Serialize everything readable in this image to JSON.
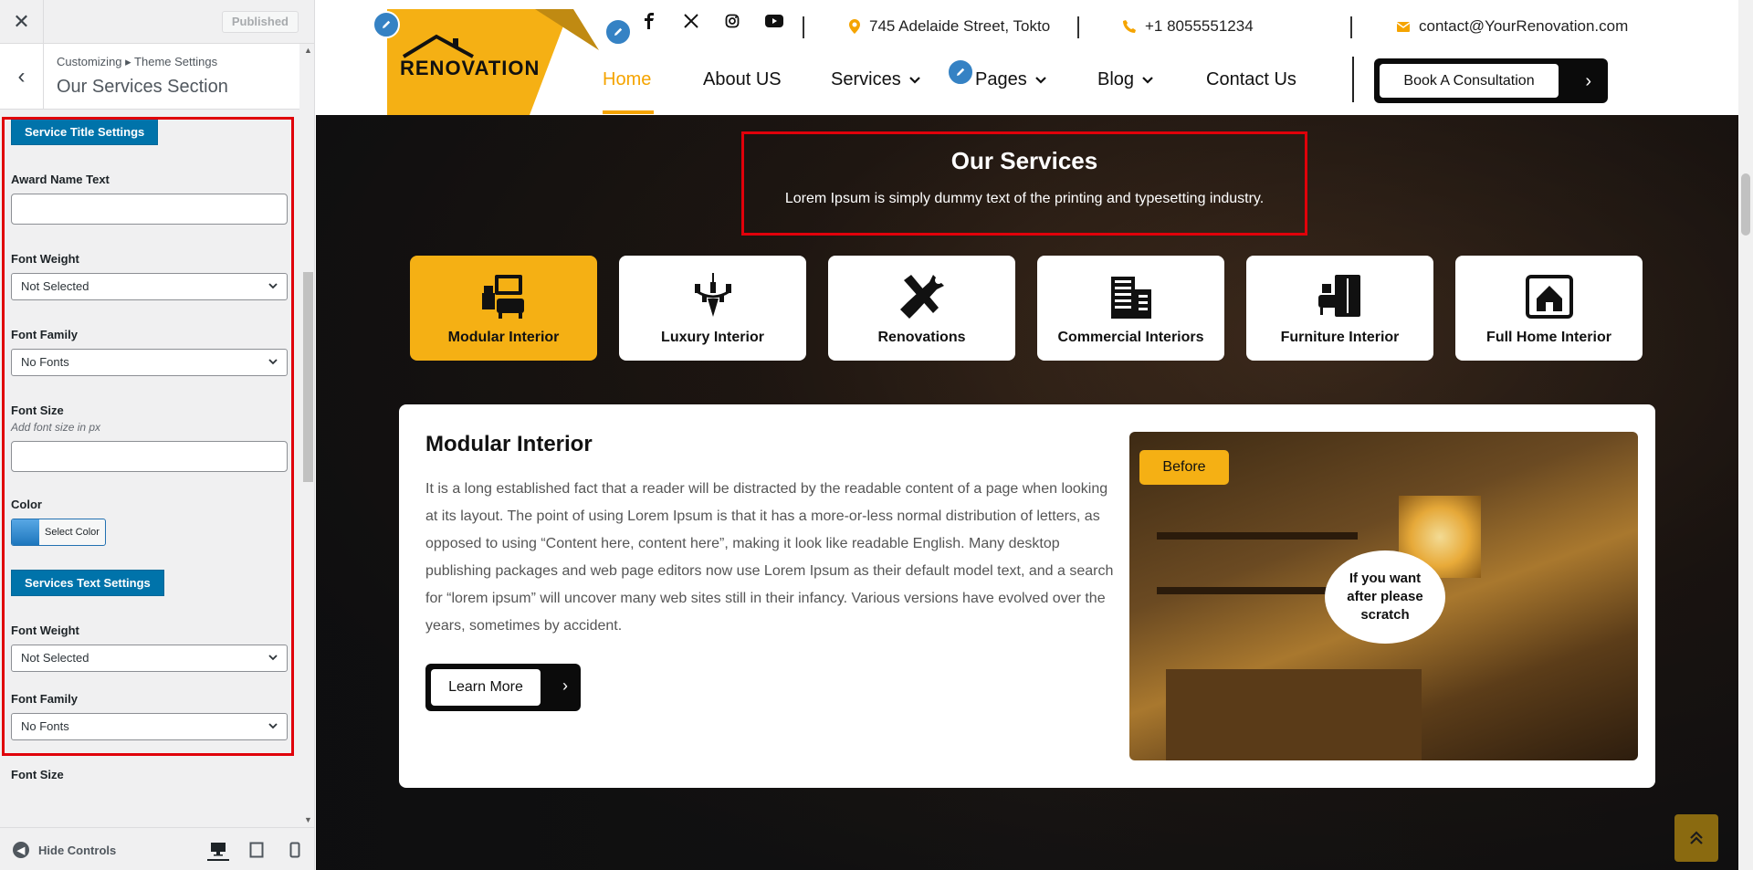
{
  "sidebar": {
    "close_icon": "close-icon",
    "published_label": "Published",
    "breadcrumb": "Customizing ▸ Theme Settings",
    "title": "Our Services Section",
    "service_title_settings_label": "Service Title Settings",
    "award_name_label": "Award Name Text",
    "font_weight_label": "Font Weight",
    "font_weight_value": "Not Selected",
    "font_family_label": "Font Family",
    "font_family_value": "No Fonts",
    "font_size_label": "Font Size",
    "font_size_desc": "Add font size in px",
    "color_label": "Color",
    "select_color_label": "Select Color",
    "services_text_settings_label": "Services Text Settings",
    "font_weight_label_2": "Font Weight",
    "font_weight_value_2": "Not Selected",
    "font_family_label_2": "Font Family",
    "font_family_value_2": "No Fonts",
    "font_size_label_2": "Font Size",
    "hide_controls_label": "Hide Controls"
  },
  "header": {
    "logo_text": "RENOVATION",
    "address": "745 Adelaide Street, Tokto",
    "phone": "+1 8055551234",
    "email": "contact@YourRenovation.com",
    "nav": {
      "home": "Home",
      "about": "About US",
      "services": "Services",
      "pages": "Pages",
      "blog": "Blog",
      "contact": "Contact Us"
    },
    "book_label": "Book A Consultation"
  },
  "services": {
    "title": "Our Services",
    "subtitle": "Lorem Ipsum is simply dummy text of the printing and typesetting industry.",
    "tabs": [
      {
        "label": "Modular Interior"
      },
      {
        "label": "Luxury Interior"
      },
      {
        "label": "Renovations"
      },
      {
        "label": "Commercial Interiors"
      },
      {
        "label": "Furniture Interior"
      },
      {
        "label": "Full Home Interior"
      }
    ],
    "detail": {
      "title": "Modular Interior",
      "text": "It is a long established fact that a reader will be distracted by the readable content of a page when looking at its layout. The point of using Lorem Ipsum is that it has a more-or-less normal distribution of letters, as opposed to using “Content here, content here”, making it look like readable English. Many desktop publishing packages and web page editors now use Lorem Ipsum as their default model text, and a search for “lorem ipsum” will uncover many web sites still in their infancy. Various versions have evolved over the years, sometimes by accident.",
      "learn_more": "Learn More",
      "before_label": "Before",
      "scratch_text": "If you want after please scratch"
    }
  },
  "colors": {
    "accent": "#f5b014",
    "wp_blue": "#0073aa",
    "highlight_red": "#e0000a"
  }
}
